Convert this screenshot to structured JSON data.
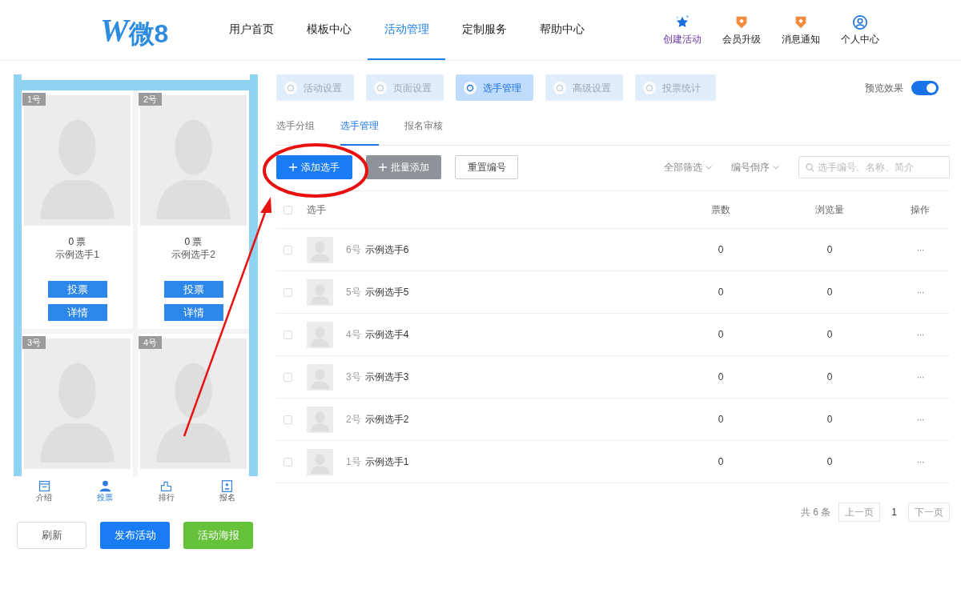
{
  "logo": {
    "text": "微8",
    "mark": "W"
  },
  "nav": [
    {
      "label": "用户首页",
      "selected": false
    },
    {
      "label": "模板中心",
      "selected": false
    },
    {
      "label": "活动管理",
      "selected": true
    },
    {
      "label": "定制服务",
      "selected": false
    },
    {
      "label": "帮助中心",
      "selected": false
    }
  ],
  "header_actions": [
    {
      "label": "创建活动",
      "kind": "star"
    },
    {
      "label": "会员升级",
      "kind": "badge"
    },
    {
      "label": "消息通知",
      "kind": "badge"
    },
    {
      "label": "个人中心",
      "kind": "user"
    }
  ],
  "preview": {
    "cards": [
      {
        "number": "1号",
        "votes": "0 票",
        "name": "示例选手1",
        "vote_button": "投票",
        "detail_button": "详情"
      },
      {
        "number": "2号",
        "votes": "0 票",
        "name": "示例选手2",
        "vote_button": "投票",
        "detail_button": "详情"
      },
      {
        "number": "3号"
      },
      {
        "number": "4号"
      }
    ],
    "bottom_tabs": [
      {
        "label": "介绍",
        "kind": "intro",
        "selected": false
      },
      {
        "label": "投票",
        "kind": "vote",
        "selected": true
      },
      {
        "label": "排行",
        "kind": "rank",
        "selected": false
      },
      {
        "label": "报名",
        "kind": "signup",
        "selected": false
      }
    ]
  },
  "preview_actions": [
    {
      "label": "刷新",
      "kind": "outline"
    },
    {
      "label": "发布活动",
      "kind": "primary"
    },
    {
      "label": "活动海报",
      "kind": "success"
    }
  ],
  "steps": [
    {
      "label": "活动设置",
      "selected": false
    },
    {
      "label": "页面设置",
      "selected": false
    },
    {
      "label": "选手管理",
      "selected": true
    },
    {
      "label": "高级设置",
      "selected": false
    },
    {
      "label": "投票统计",
      "selected": false
    }
  ],
  "preview_toggle": {
    "label": "预览效果",
    "on": true
  },
  "sub_tabs": [
    {
      "label": "选手分组",
      "selected": false
    },
    {
      "label": "选手管理",
      "selected": true
    },
    {
      "label": "报名审核",
      "selected": false
    }
  ],
  "toolbar": [
    {
      "label": "添加选手",
      "kind": "primary"
    },
    {
      "label": "批量添加",
      "kind": "gray"
    },
    {
      "label": "重置编号",
      "kind": "outline"
    }
  ],
  "filters": [
    "全部筛选",
    "编号倒序"
  ],
  "search": {
    "placeholder": "选手编号、名称、简介"
  },
  "table": {
    "columns": [
      "选手",
      "票数",
      "浏览量",
      "操作"
    ],
    "select_all_checked": false,
    "rows": [
      {
        "number": "6号",
        "name": "示例选手6",
        "votes": "0",
        "views": "0",
        "actions": "···",
        "checked": false
      },
      {
        "number": "5号",
        "name": "示例选手5",
        "votes": "0",
        "views": "0",
        "actions": "···",
        "checked": false
      },
      {
        "number": "4号",
        "name": "示例选手4",
        "votes": "0",
        "views": "0",
        "actions": "···",
        "checked": false
      },
      {
        "number": "3号",
        "name": "示例选手3",
        "votes": "0",
        "views": "0",
        "actions": "···",
        "checked": false
      },
      {
        "number": "2号",
        "name": "示例选手2",
        "votes": "0",
        "views": "0",
        "actions": "···",
        "checked": false
      },
      {
        "number": "1号",
        "name": "示例选手1",
        "votes": "0",
        "views": "0",
        "actions": "···",
        "checked": false
      }
    ]
  },
  "pagination": {
    "total": "共 6 条",
    "prev": "上一页",
    "pages": [
      {
        "label": "1",
        "selected": true
      }
    ],
    "next": "下一页"
  }
}
